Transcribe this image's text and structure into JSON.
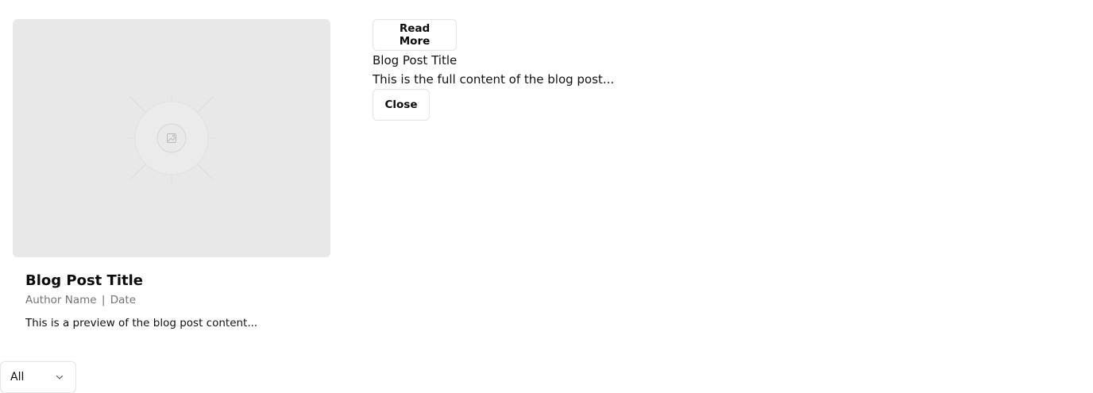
{
  "card": {
    "image_icon": "image-placeholder-icon",
    "title": "Blog Post Title",
    "author": "Author Name",
    "separator": "|",
    "date": "Date",
    "preview": "This is a preview of the blog post content..."
  },
  "detail": {
    "read_more_label": "Read More",
    "title": "Blog Post Title",
    "content": "This is the full content of the blog post...",
    "close_label": "Close"
  },
  "filter": {
    "selected": "All",
    "icon": "chevron-down-icon"
  },
  "colors": {
    "placeholder_bg": "#e8e8e8",
    "border": "#e4e4e7",
    "muted_text": "#737373"
  }
}
